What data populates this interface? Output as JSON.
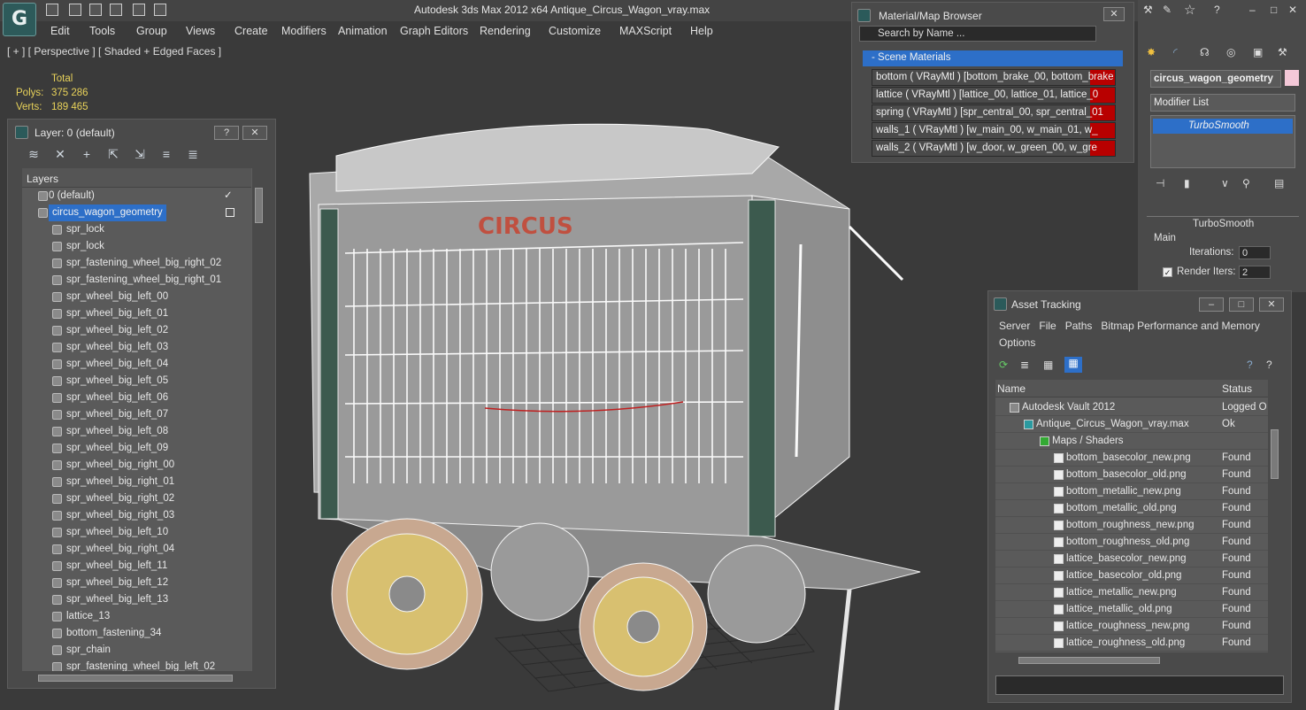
{
  "app": {
    "title": "Autodesk 3ds Max  2012 x64       Antique_Circus_Wagon_vray.max",
    "logo_icon": "3dsmax-logo-icon"
  },
  "menu": [
    "Edit",
    "Tools",
    "Group",
    "Views",
    "Create",
    "Modifiers",
    "Animation",
    "Graph Editors",
    "Rendering",
    "Customize",
    "MAXScript",
    "Help"
  ],
  "viewport": {
    "label": "[ + ] [ Perspective ] [ Shaded + Edged Faces ]",
    "stats_header": "Total",
    "polys_label": "Polys:",
    "polys_value": "375 286",
    "verts_label": "Verts:",
    "verts_value": "189 465",
    "scene_text": "CIRCUS"
  },
  "layer_panel": {
    "title": "Layer: 0 (default)",
    "help_btn": "?",
    "close_btn": "✕",
    "header": "Layers",
    "rows": [
      {
        "label": "0 (default)",
        "indent": 0
      },
      {
        "label": "circus_wagon_geometry",
        "indent": 0
      },
      {
        "label": "spr_lock",
        "indent": 1
      },
      {
        "label": "spr_lock",
        "indent": 1
      },
      {
        "label": "spr_fastening_wheel_big_right_02",
        "indent": 1
      },
      {
        "label": "spr_fastening_wheel_big_right_01",
        "indent": 1
      },
      {
        "label": "spr_wheel_big_left_00",
        "indent": 1
      },
      {
        "label": "spr_wheel_big_left_01",
        "indent": 1
      },
      {
        "label": "spr_wheel_big_left_02",
        "indent": 1
      },
      {
        "label": "spr_wheel_big_left_03",
        "indent": 1
      },
      {
        "label": "spr_wheel_big_left_04",
        "indent": 1
      },
      {
        "label": "spr_wheel_big_left_05",
        "indent": 1
      },
      {
        "label": "spr_wheel_big_left_06",
        "indent": 1
      },
      {
        "label": "spr_wheel_big_left_07",
        "indent": 1
      },
      {
        "label": "spr_wheel_big_left_08",
        "indent": 1
      },
      {
        "label": "spr_wheel_big_left_09",
        "indent": 1
      },
      {
        "label": "spr_wheel_big_right_00",
        "indent": 1
      },
      {
        "label": "spr_wheel_big_right_01",
        "indent": 1
      },
      {
        "label": "spr_wheel_big_right_02",
        "indent": 1
      },
      {
        "label": "spr_wheel_big_right_03",
        "indent": 1
      },
      {
        "label": "spr_wheel_big_left_10",
        "indent": 1
      },
      {
        "label": "spr_wheel_big_right_04",
        "indent": 1
      },
      {
        "label": "spr_wheel_big_left_11",
        "indent": 1
      },
      {
        "label": "spr_wheel_big_left_12",
        "indent": 1
      },
      {
        "label": "spr_wheel_big_left_13",
        "indent": 1
      },
      {
        "label": "lattice_13",
        "indent": 1
      },
      {
        "label": "bottom_fastening_34",
        "indent": 1
      },
      {
        "label": "spr_chain",
        "indent": 1
      },
      {
        "label": "spr_fastening_wheel_big_left_02",
        "indent": 1
      }
    ]
  },
  "material_browser": {
    "title": "Material/Map Browser",
    "search_placeholder": "Search by Name ...",
    "group": "- Scene Materials",
    "rows": [
      "bottom  ( VRayMtl ) [bottom_brake_00, bottom_brake",
      "lattice  ( VRayMtl ) [lattice_00, lattice_01, lattice_0",
      "spring  ( VRayMtl ) [spr_central_00, spr_central_01",
      "walls_1  ( VRayMtl )  [w_main_00, w_main_01, w_",
      "walls_2  ( VRayMtl )  [w_door, w_green_00, w_gre"
    ]
  },
  "command_panel": {
    "object_name": "circus_wagon_geometry",
    "modifier_list": "Modifier List",
    "stack_item": "TurboSmooth",
    "rollout_title": "TurboSmooth",
    "group_main": "Main",
    "iterations_label": "Iterations:",
    "iterations_value": "0",
    "render_iters_label": "Render Iters:",
    "render_iters_value": "2"
  },
  "asset_tracking": {
    "title": "Asset Tracking",
    "menu": [
      "Server",
      "File",
      "Paths",
      "Bitmap Performance and Memory",
      "Options"
    ],
    "col_name": "Name",
    "col_status": "Status",
    "rows": [
      {
        "name": "Autodesk Vault 2012",
        "status": "Logged O",
        "indent": 0
      },
      {
        "name": "Antique_Circus_Wagon_vray.max",
        "status": "Ok",
        "indent": 1
      },
      {
        "name": "Maps / Shaders",
        "status": "",
        "indent": 2
      },
      {
        "name": "bottom_basecolor_new.png",
        "status": "Found",
        "indent": 3
      },
      {
        "name": "bottom_basecolor_old.png",
        "status": "Found",
        "indent": 3
      },
      {
        "name": "bottom_metallic_new.png",
        "status": "Found",
        "indent": 3
      },
      {
        "name": "bottom_metallic_old.png",
        "status": "Found",
        "indent": 3
      },
      {
        "name": "bottom_roughness_new.png",
        "status": "Found",
        "indent": 3
      },
      {
        "name": "bottom_roughness_old.png",
        "status": "Found",
        "indent": 3
      },
      {
        "name": "lattice_basecolor_new.png",
        "status": "Found",
        "indent": 3
      },
      {
        "name": "lattice_basecolor_old.png",
        "status": "Found",
        "indent": 3
      },
      {
        "name": "lattice_metallic_new.png",
        "status": "Found",
        "indent": 3
      },
      {
        "name": "lattice_metallic_old.png",
        "status": "Found",
        "indent": 3
      },
      {
        "name": "lattice_roughness_new.png",
        "status": "Found",
        "indent": 3
      },
      {
        "name": "lattice_roughness_old.png",
        "status": "Found",
        "indent": 3
      }
    ]
  },
  "colors": {
    "selection": "#2d6fc8",
    "stats_text": "#e8d25a",
    "material_swatch": "#b80000",
    "object_color": "#f4c8d8"
  }
}
